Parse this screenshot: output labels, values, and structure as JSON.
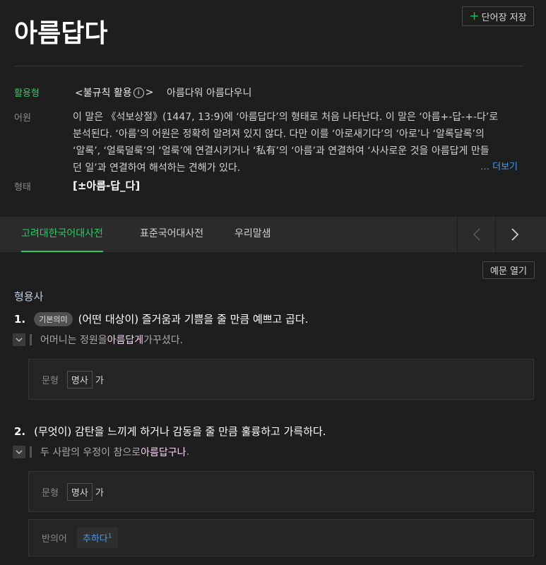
{
  "word": "아름답다",
  "save_label": "단어장 저장",
  "rows": {
    "conjugation_label": "활용형",
    "irregular_open": "<불규칙 활용",
    "irregular_close": ">",
    "info_glyph": "i",
    "forms": "아름다워 아름다우니",
    "etymology_label": "어원",
    "etymology_lines": [
      "이 말은 《석보상절》(1447, 13:9)에 ‘아름답다’의 형태로 처음 나타난다. 이 말은 ‘아름+-답-+-다’로",
      "분석된다. ‘아름’의 어원은 정확히 알려져 있지 않다. 다만 이를 ‘아로새기다’의 ‘아로’나 ‘알록달록’의",
      "‘알록’, ‘얼룩덜룩’의 ‘얼룩’에 연결시키거나 ‘私有’의 ‘아름’과 연결하여 ‘사사로운 것을 아름답게 만들",
      "던 일’과 연결하여 해석하는 견해가 있다."
    ],
    "more_ellipsis": "…",
    "more_label": "더보기",
    "form_label": "형태",
    "form_value": "[±아름-답_다]"
  },
  "dict_tabs": [
    "고려대한국어대사전",
    "표준국어대사전",
    "우리말샘"
  ],
  "example_toggle": "예문 열기",
  "pos": "형용사",
  "senses": [
    {
      "num": "1.",
      "badge": "기본의미",
      "text": "(어떤 대상이) 즐거움과 기쁨을 줄 만큼 예쁘고 곱다.",
      "example_pre": "어머니는 정원을 ",
      "example_hl": "아름답게",
      "example_post": " 가꾸셨다.",
      "pattern_label": "문형",
      "pattern_chip": "명사",
      "pattern_after": "가"
    },
    {
      "num": "2.",
      "text": "(무엇이) 감탄을 느끼게 하거나 감동을 줄 만큼 훌륭하고 가륵하다.",
      "example_pre": "두 사람의 우정이 참으로 ",
      "example_hl": "아름답구나",
      "example_post": ".",
      "pattern_label": "문형",
      "pattern_chip": "명사",
      "pattern_after": "가",
      "antonym_label": "반의어",
      "antonym_value": "추하다",
      "antonym_sup": "1"
    }
  ],
  "colors": {
    "accent_green": "#2ec764",
    "link_blue": "#4d97e8",
    "highlight_pink": "#f3d6f0"
  }
}
